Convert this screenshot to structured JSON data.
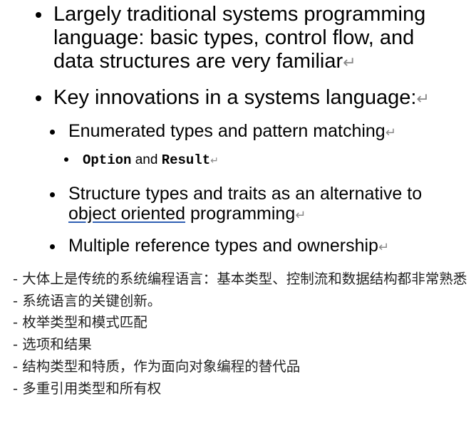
{
  "slide": {
    "items": [
      {
        "level": 1,
        "lines": [
          "Largely traditional systems programming",
          "language: basic types, control flow, and",
          "data structures are very familiar"
        ]
      },
      {
        "level": 1,
        "text": "Key innovations in a systems language:"
      },
      {
        "level": 2,
        "text": "Enumerated types and pattern matching"
      },
      {
        "level": 3,
        "code1": "Option",
        "joiner": " and ",
        "code2": "Result"
      },
      {
        "level": 2,
        "line1": "Structure types and traits as an alternative to",
        "line2_link": "object oriented",
        "line2_rest": " programming"
      },
      {
        "level": 2,
        "text": "Multiple reference types and ownership"
      }
    ],
    "paragraph_mark": "↵"
  },
  "translations": [
    "- 大体上是传统的系统编程语言：基本类型、控制流和数据结构都非常熟悉",
    "- 系统语言的关键创新。",
    "- 枚举类型和模式匹配",
    "- 选项和结果",
    "- 结构类型和特质，作为面向对象编程的替代品",
    "- 多重引用类型和所有权"
  ]
}
